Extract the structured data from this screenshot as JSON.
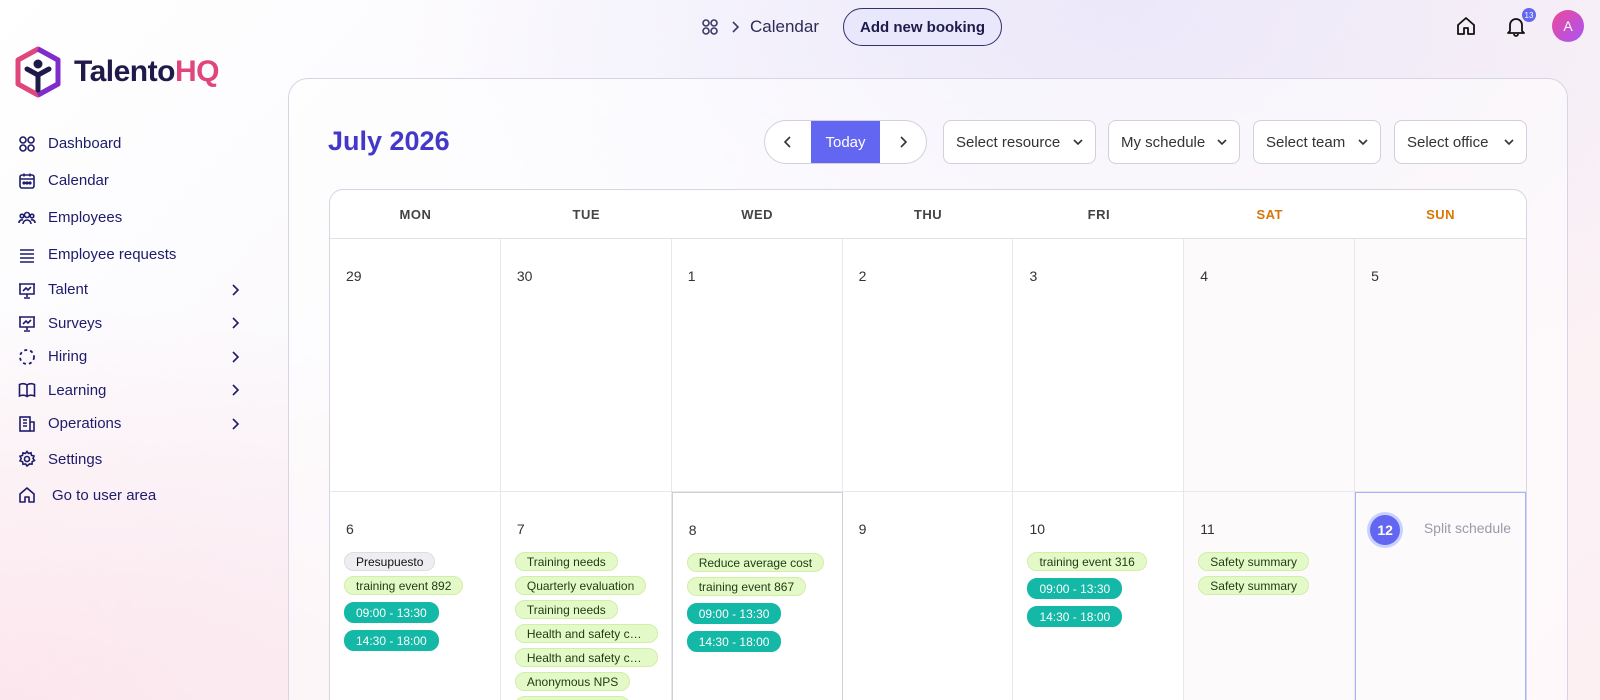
{
  "breadcrumb": {
    "current": "Calendar"
  },
  "topbar": {
    "add_booking": "Add new booking",
    "notification_count": "13",
    "avatar_initial": "A"
  },
  "brand": {
    "name_part1": "Talento",
    "name_part2": "HQ",
    "accent": "#e0457b",
    "primary": "#6366f1"
  },
  "sidebar": {
    "items": [
      {
        "label": "Dashboard",
        "icon": "grid-icon",
        "has_children": false
      },
      {
        "label": "Calendar",
        "icon": "calendar-icon",
        "has_children": false
      },
      {
        "label": "Employees",
        "icon": "users-icon",
        "has_children": false
      },
      {
        "label": "Employee requests",
        "icon": "list-icon",
        "has_children": false
      },
      {
        "label": "Talent",
        "icon": "presentation-icon",
        "has_children": true
      },
      {
        "label": "Surveys",
        "icon": "presentation-icon",
        "has_children": true
      },
      {
        "label": "Hiring",
        "icon": "dashed-circle-icon",
        "has_children": true
      },
      {
        "label": "Learning",
        "icon": "book-icon",
        "has_children": true
      },
      {
        "label": "Operations",
        "icon": "building-icon",
        "has_children": true
      },
      {
        "label": "Settings",
        "icon": "gear-icon",
        "has_children": false
      },
      {
        "label": "Go to user area",
        "icon": "home-icon",
        "has_children": false
      }
    ]
  },
  "calendar": {
    "month_title": "July 2026",
    "today_label": "Today",
    "filters": {
      "resource": "Select resource",
      "schedule": "My schedule",
      "team": "Select team",
      "office": "Select office"
    },
    "weekdays": [
      "MON",
      "TUE",
      "WED",
      "THU",
      "FRI",
      "SAT",
      "SUN"
    ],
    "weeks": [
      {
        "days": [
          {
            "num": "29",
            "events": []
          },
          {
            "num": "30",
            "events": []
          },
          {
            "num": "1",
            "events": []
          },
          {
            "num": "2",
            "events": []
          },
          {
            "num": "3",
            "events": []
          },
          {
            "num": "4",
            "events": []
          },
          {
            "num": "5",
            "events": []
          }
        ]
      },
      {
        "days": [
          {
            "num": "6",
            "events": [
              {
                "text": "Presupuesto",
                "kind": "gray"
              },
              {
                "text": "training event 892",
                "kind": "green"
              },
              {
                "text": "09:00 - 13:30",
                "kind": "teal"
              },
              {
                "text": "14:30 - 18:00",
                "kind": "teal"
              }
            ]
          },
          {
            "num": "7",
            "events": [
              {
                "text": "Training needs",
                "kind": "green"
              },
              {
                "text": "Quarterly evaluation",
                "kind": "green"
              },
              {
                "text": "Training needs",
                "kind": "green"
              },
              {
                "text": "Health and safety check",
                "kind": "green"
              },
              {
                "text": "Health and safety check",
                "kind": "green"
              },
              {
                "text": "Anonymous NPS",
                "kind": "green"
              },
              {
                "text": "Anonymous NPS",
                "kind": "green"
              }
            ]
          },
          {
            "num": "8",
            "selected": true,
            "events": [
              {
                "text": "Reduce average cost",
                "kind": "green"
              },
              {
                "text": "training event 867",
                "kind": "green"
              },
              {
                "text": "09:00 - 13:30",
                "kind": "teal"
              },
              {
                "text": "14:30 - 18:00",
                "kind": "teal"
              }
            ]
          },
          {
            "num": "9",
            "events": []
          },
          {
            "num": "10",
            "events": [
              {
                "text": "training event 316",
                "kind": "green"
              },
              {
                "text": "09:00 - 13:30",
                "kind": "teal"
              },
              {
                "text": "14:30 - 18:00",
                "kind": "teal"
              }
            ]
          },
          {
            "num": "11",
            "events": [
              {
                "text": "Safety summary",
                "kind": "green"
              },
              {
                "text": "Safety summary",
                "kind": "green"
              }
            ]
          },
          {
            "num": "12",
            "today": true,
            "note": "Split schedule",
            "events": []
          }
        ]
      }
    ]
  }
}
